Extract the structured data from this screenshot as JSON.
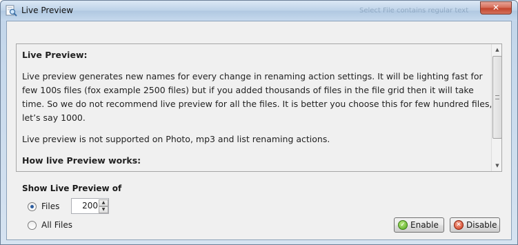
{
  "window": {
    "title": "Live Preview",
    "background_text": "Select File contains regular text",
    "close_label": "✕"
  },
  "content": {
    "heading": "Live Preview:",
    "paragraph1": "Live preview generates new names for every change in renaming action settings. It will be lighting fast for few 100s files (fox example 2500 files) but if you added thousands of files in the file grid then it will take time. So we do not recommend live preview for all the files. It is better you choose this for few hundred files, let’s say 1000.",
    "paragraph2": "Live preview is not supported on Photo, mp3 and list renaming actions.",
    "heading2": "How live Preview works:"
  },
  "options": {
    "group_label": "Show Live Preview of",
    "files_label": "Files",
    "files_selected": true,
    "all_files_label": "All Files",
    "all_files_selected": false,
    "files_count": "200"
  },
  "buttons": {
    "enable_label": "Enable",
    "disable_label": "Disable"
  },
  "icons": {
    "title_icon": "magnifier-document-icon",
    "enable_icon": "green-check-icon",
    "disable_icon": "red-x-icon"
  },
  "colors": {
    "enable_green": "#4fa51c",
    "disable_red": "#d03a1c",
    "close_red": "#c3452d",
    "radio_dot": "#2b5c9e"
  }
}
